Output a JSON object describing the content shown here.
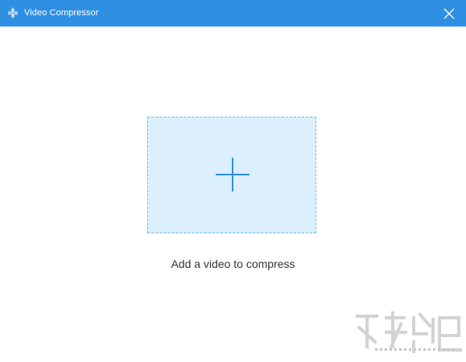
{
  "window": {
    "title": "Video Compressor",
    "title_icon": "compress-icon",
    "close_icon": "close-icon"
  },
  "main": {
    "dropzone_icon": "plus-icon",
    "add_label": "Add a video to compress"
  },
  "colors": {
    "titlebar": "#2f8fe3",
    "dropzone_fill": "#dbefff",
    "dropzone_border": "#6bbde8",
    "plus": "#2f8fe3",
    "text": "#333333"
  }
}
